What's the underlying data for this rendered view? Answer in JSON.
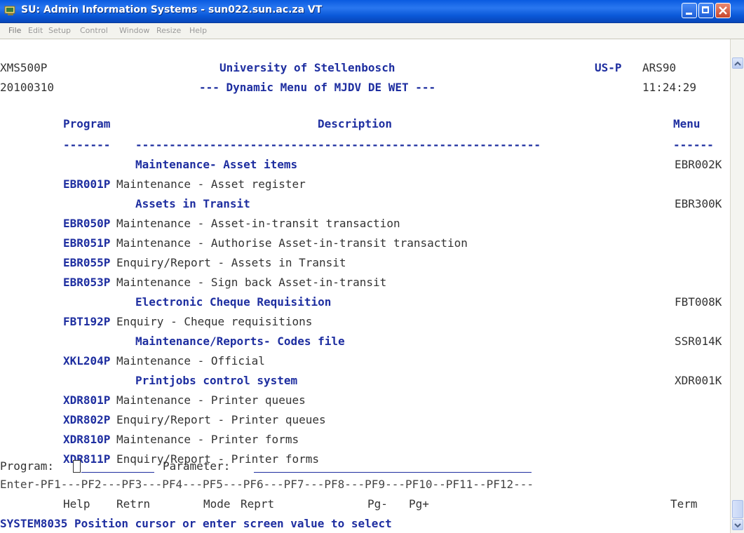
{
  "window": {
    "title": "SU: Admin Information Systems - sun022.sun.ac.za VT"
  },
  "menubar": {
    "items": [
      "File",
      "Edit",
      "Setup",
      "Control",
      "Window",
      "Resize",
      "Help"
    ]
  },
  "header": {
    "screen_id": "XMS500P",
    "org": "University of Stellenbosch",
    "region": "US-P",
    "system": "ARS90",
    "date": "20100310",
    "menu_title": "--- Dynamic Menu of MJDV DE WET ---",
    "time": "11:24:29"
  },
  "columns": {
    "program": "Program",
    "description": "Description",
    "menu": "Menu",
    "rule_program": "-------",
    "rule_description": "------------------------------------------------------------",
    "rule_menu": "------"
  },
  "rows": [
    {
      "program": "",
      "description": "Maintenance- Asset items",
      "menu": "EBR002K",
      "heading": true
    },
    {
      "program": "EBR001P",
      "description": "Maintenance - Asset register",
      "menu": "",
      "heading": false
    },
    {
      "program": "",
      "description": "Assets in Transit",
      "menu": "EBR300K",
      "heading": true
    },
    {
      "program": "EBR050P",
      "description": "Maintenance - Asset-in-transit transaction",
      "menu": "",
      "heading": false
    },
    {
      "program": "EBR051P",
      "description": "Maintenance - Authorise Asset-in-transit transaction",
      "menu": "",
      "heading": false
    },
    {
      "program": "EBR055P",
      "description": "Enquiry/Report - Assets in Transit",
      "menu": "",
      "heading": false
    },
    {
      "program": "EBR053P",
      "description": "Maintenance - Sign back Asset-in-transit",
      "menu": "",
      "heading": false
    },
    {
      "program": "",
      "description": "Electronic Cheque Requisition",
      "menu": "FBT008K",
      "heading": true
    },
    {
      "program": "FBT192P",
      "description": "Enquiry - Cheque requisitions",
      "menu": "",
      "heading": false
    },
    {
      "program": "",
      "description": "Maintenance/Reports- Codes file",
      "menu": "SSR014K",
      "heading": true
    },
    {
      "program": "XKL204P",
      "description": "Maintenance - Official",
      "menu": "",
      "heading": false
    },
    {
      "program": "",
      "description": "Printjobs control system",
      "menu": "XDR001K",
      "heading": true
    },
    {
      "program": "XDR801P",
      "description": "Maintenance - Printer queues",
      "menu": "",
      "heading": false
    },
    {
      "program": "XDR802P",
      "description": "Enquiry/Report - Printer queues",
      "menu": "",
      "heading": false
    },
    {
      "program": "XDR810P",
      "description": "Maintenance - Printer forms",
      "menu": "",
      "heading": false
    },
    {
      "program": "XDR811P",
      "description": "Enquiry/Report - Printer forms",
      "menu": "",
      "heading": false
    }
  ],
  "inputs": {
    "program_label": "Program:",
    "program_value": "",
    "parameter_label": "Parameter:",
    "parameter_value": ""
  },
  "function_keys": {
    "bar": "Enter-PF1---PF2---PF3---PF4---PF5---PF6---PF7---PF8---PF9---PF10--PF11--PF12---",
    "labels": [
      {
        "key": "PF1",
        "label": "Help"
      },
      {
        "key": "PF2",
        "label": "Retrn"
      },
      {
        "key": "PF4",
        "label": "Mode"
      },
      {
        "key": "PF5",
        "label": "Reprt"
      },
      {
        "key": "PF7",
        "label": "Pg-"
      },
      {
        "key": "PF8",
        "label": "Pg+"
      },
      {
        "key": "PF12",
        "label": "Term"
      }
    ]
  },
  "status": {
    "message": "SYSTEM8035 Position cursor or enter screen value to select"
  },
  "colors": {
    "titlebar": "#0a5be0",
    "accent_text": "#1e2ea0",
    "terminal_bg": "#ffffff"
  }
}
